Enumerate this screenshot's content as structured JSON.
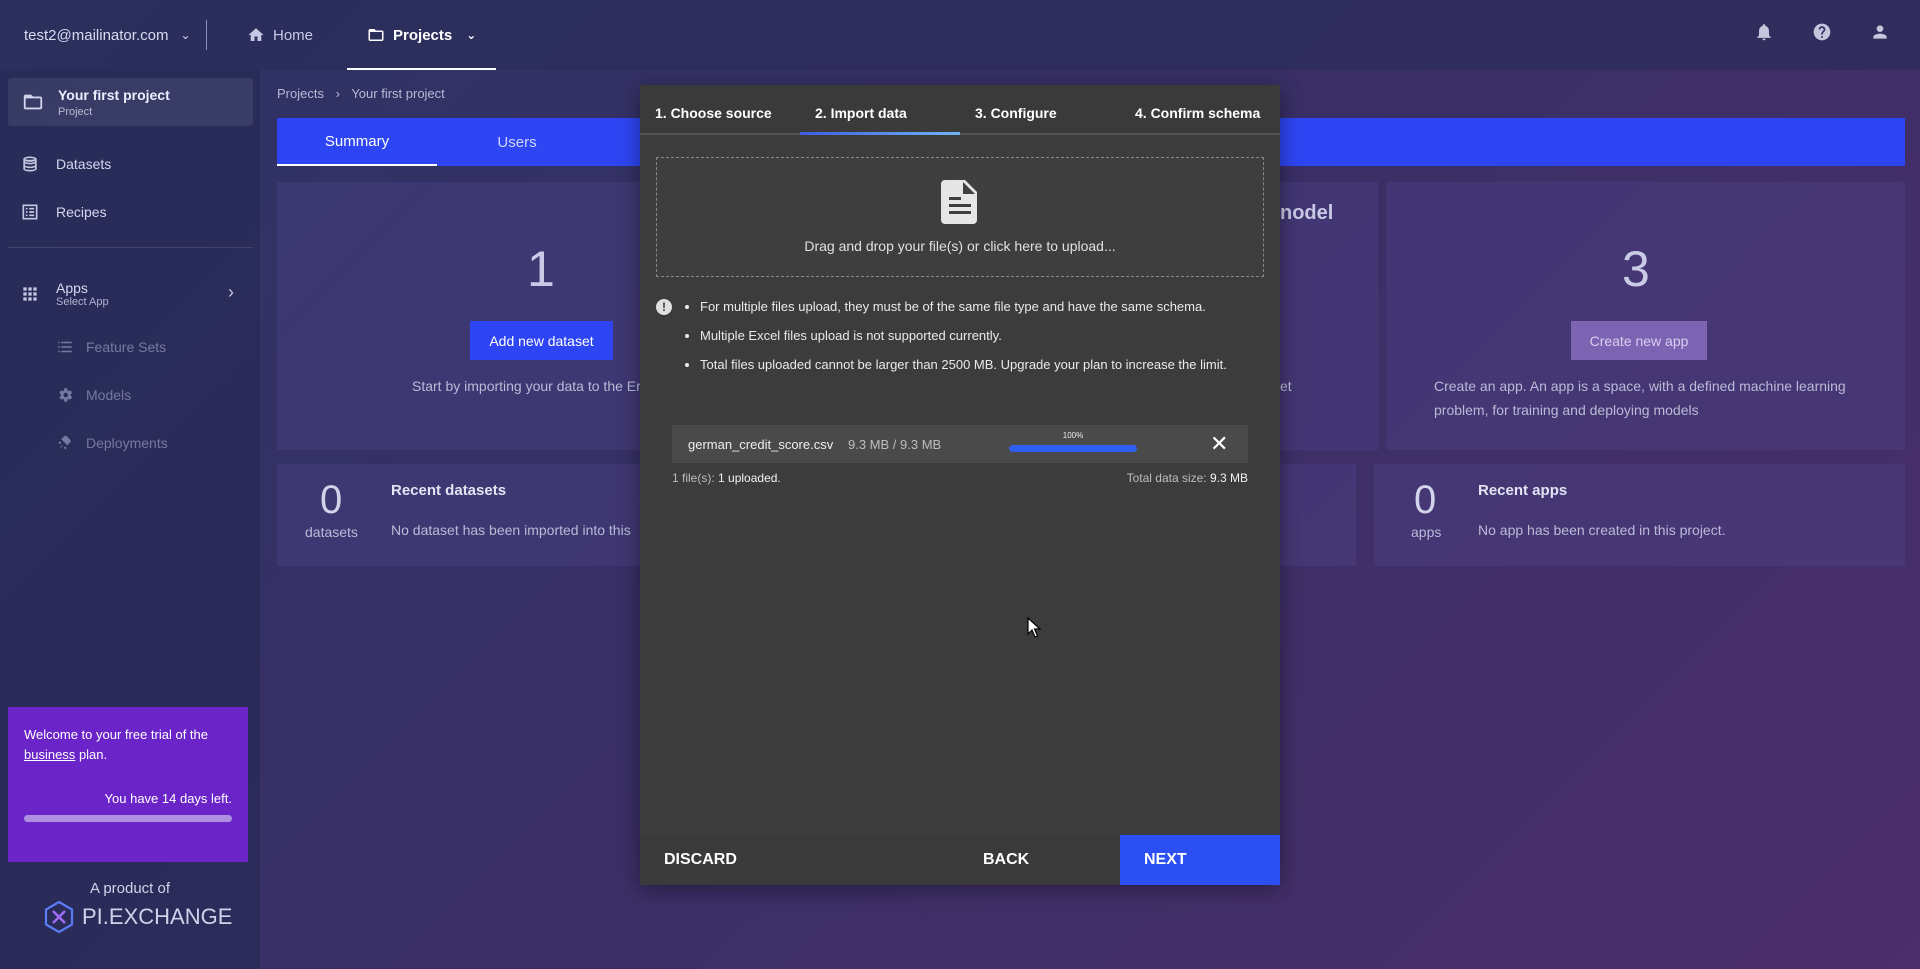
{
  "topbar": {
    "user_email": "test2@mailinator.com",
    "nav": [
      {
        "label": "Home"
      },
      {
        "label": "Projects"
      }
    ]
  },
  "sidebar": {
    "project_title": "Your first project",
    "project_sub": "Project",
    "items": [
      {
        "label": "Datasets"
      },
      {
        "label": "Recipes"
      }
    ],
    "apps_label": "Apps",
    "apps_sub": "Select App",
    "sub_items": [
      {
        "label": "Feature Sets"
      },
      {
        "label": "Models"
      },
      {
        "label": "Deployments"
      }
    ],
    "trial_prefix": "Welcome to your free trial of the",
    "trial_plan": "business",
    "trial_suffix": "plan.",
    "trial_days": "You have 14 days left.",
    "product_of": "A product of",
    "logo_text": "PI.EXCHANGE"
  },
  "main": {
    "breadcrumb": [
      "Projects",
      "Your first project"
    ],
    "tabs": [
      {
        "label": "Summary"
      },
      {
        "label": "Users"
      }
    ],
    "dataset_count": "1",
    "add_dataset_label": "Add new dataset",
    "dataset_desc": "Start by importing your data to the Er",
    "model_heading": "nodel",
    "model_desc": "et",
    "app_count": "3",
    "create_app_label": "Create new app",
    "app_desc": "Create an app. An app is a space, with a defined machine learning problem, for training and deploying models",
    "recent_datasets": {
      "count": "0",
      "unit": "datasets",
      "title": "Recent datasets",
      "text": "No dataset has been imported into this"
    },
    "recent_apps": {
      "count": "0",
      "unit": "apps",
      "title": "Recent apps",
      "text": "No app has been created in this project."
    }
  },
  "modal": {
    "steps": [
      {
        "label": "1. Choose source"
      },
      {
        "label": "2. Import data"
      },
      {
        "label": "3. Configure"
      },
      {
        "label": "4. Confirm schema"
      }
    ],
    "drop_text": "Drag and drop your file(s) or click here to upload...",
    "notes": [
      "For multiple files upload, they must be of the same file type and have the same schema.",
      "Multiple Excel files upload is not supported currently.",
      "Total files uploaded cannot be larger than 2500 MB. Upgrade your plan to increase the limit."
    ],
    "file": {
      "name": "german_credit_score.csv",
      "size": "9.3 MB / 9.3 MB",
      "progress_label": "100%",
      "progress": 1.0
    },
    "summary_left_prefix": "1 file(s):",
    "summary_left_value": "1 uploaded.",
    "summary_right_prefix": "Total data size:",
    "summary_right_value": "9.3 MB",
    "discard_label": "DISCARD",
    "back_label": "BACK",
    "next_label": "NEXT"
  },
  "colors": {
    "accent": "#2d45f2",
    "trial": "#6a24c8",
    "modal": "#3c3c3c"
  }
}
